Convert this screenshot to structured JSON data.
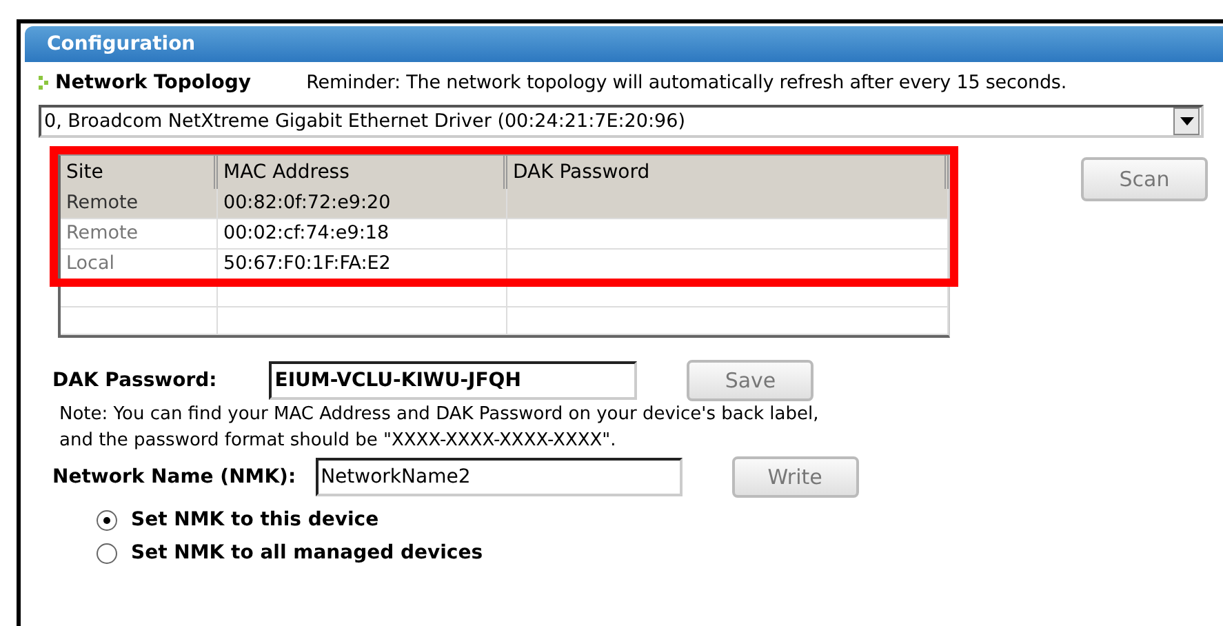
{
  "panel": {
    "title": "Configuration"
  },
  "topology": {
    "heading": "Network Topology",
    "reminder": "Reminder: The network topology will automatically refresh after every 15 seconds."
  },
  "adapter_dropdown": {
    "value": "0, Broadcom NetXtreme Gigabit Ethernet Driver (00:24:21:7E:20:96)"
  },
  "table": {
    "columns": [
      "Site",
      "MAC Address",
      "DAK Password"
    ],
    "rows": [
      {
        "site": "Remote",
        "mac": "00:82:0f:72:e9:20",
        "selected": true
      },
      {
        "site": "Remote",
        "mac": "00:02:cf:74:e9:18",
        "selected": false
      },
      {
        "site": "Local",
        "mac": "50:67:F0:1F:FA:E2",
        "selected": false
      }
    ],
    "highlighted": true
  },
  "scan_button": {
    "label": "Scan",
    "disabled": true
  },
  "dak": {
    "label": "DAK Password:",
    "value": "EIUM-VCLU-KIWU-JFQH",
    "button": "Save",
    "disabled": true
  },
  "note": [
    "Note: You can find your MAC Address and DAK Password on your device's back label,",
    "and the password format should be \"XXXX-XXXX-XXXX-XXXX\"."
  ],
  "nmk": {
    "label": "Network Name (NMK):",
    "value": "NetworkName2",
    "button": "Write",
    "disabled": true
  },
  "radios": [
    {
      "label": "Set NMK to this device",
      "selected": true
    },
    {
      "label": "Set NMK to all managed devices",
      "selected": false
    }
  ]
}
